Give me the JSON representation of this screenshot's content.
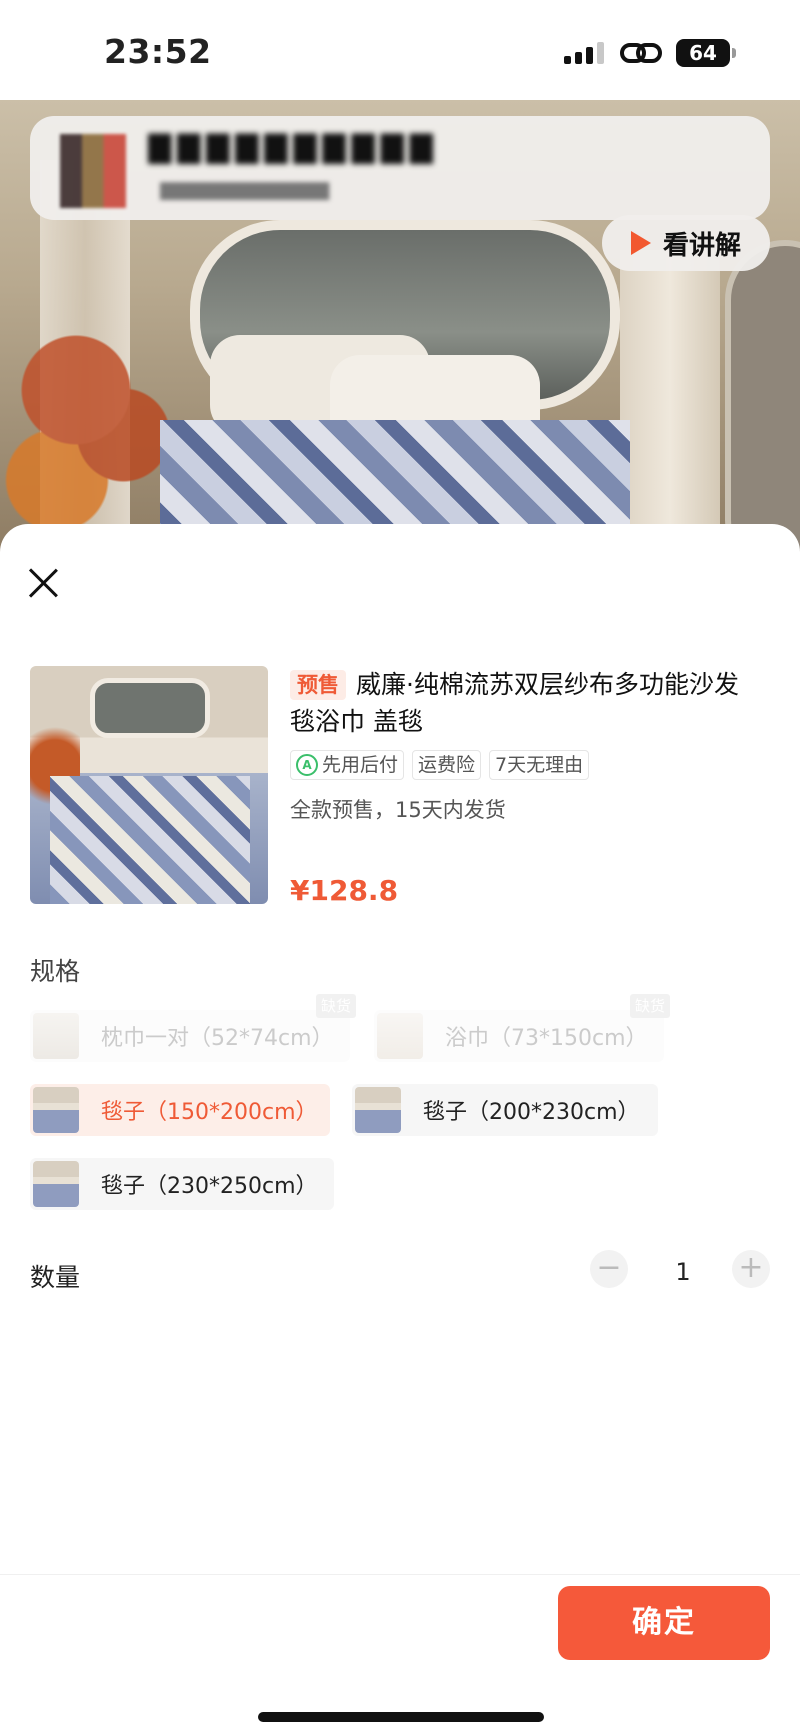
{
  "status_bar": {
    "time": "23:52",
    "battery": "64"
  },
  "live_header": {
    "watch_label": "看讲解"
  },
  "product": {
    "presale_tag": "预售",
    "title": "威廉·纯棉流苏双层纱布多功能沙发毯浴巾 盖毯",
    "service_tags": [
      "先用后付",
      "运费险",
      "7天无理由"
    ],
    "ship_note": "全款预售，15天内发货",
    "price": "¥128.8"
  },
  "spec": {
    "title": "规格",
    "out_of_stock_label": "缺货",
    "options": [
      {
        "label": "枕巾一对（52*74cm）",
        "state": "disabled"
      },
      {
        "label": "浴巾（73*150cm）",
        "state": "disabled"
      },
      {
        "label": "毯子（150*200cm）",
        "state": "selected"
      },
      {
        "label": "毯子（200*230cm）",
        "state": "normal"
      },
      {
        "label": "毯子（230*250cm）",
        "state": "normal"
      }
    ]
  },
  "quantity": {
    "label": "数量",
    "value": "1",
    "minus": "−",
    "plus": "+"
  },
  "footer": {
    "confirm_label": "确定"
  },
  "colors": {
    "accent": "#f5593a",
    "price": "#ef5a36",
    "selected_bg": "#fdeee8"
  }
}
